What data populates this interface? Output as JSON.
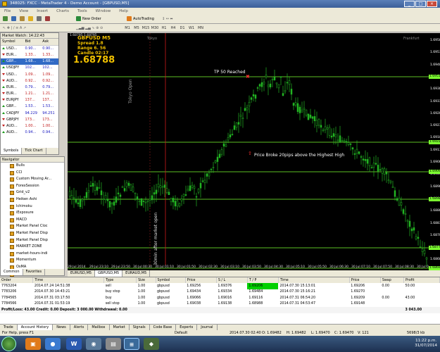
{
  "window": {
    "title": "348025: FXCC - MetaTrader 4 - Demo Account - [GBPUSD,M5]",
    "min": "_",
    "max": "□",
    "close": "×"
  },
  "menu": [
    "File",
    "View",
    "Insert",
    "Charts",
    "Tools",
    "Window",
    "Help"
  ],
  "toolbar": {
    "new_order": "New Order",
    "auto_trading": "AutoTrading",
    "timeframes": [
      "M1",
      "M5",
      "M15",
      "M30",
      "H1",
      "H4",
      "D1",
      "W1",
      "MN"
    ]
  },
  "market_watch": {
    "title": "Market Watch: 14:22:43",
    "col_symbol": "Symbol",
    "col_bid": "Bid",
    "col_ask": "Ask",
    "rows": [
      {
        "s": "USD...",
        "b": "0.90...",
        "a": "0.90...",
        "dir": "up"
      },
      {
        "s": "EUR...",
        "b": "1.33...",
        "a": "1.33...",
        "dir": "dn"
      },
      {
        "s": "GBP...",
        "b": "1.68...",
        "a": "1.68...",
        "dir": "up"
      },
      {
        "s": "USDJPY",
        "b": "102...",
        "a": "102...",
        "dir": "up"
      },
      {
        "s": "USD...",
        "b": "1.09...",
        "a": "1.09...",
        "dir": "dn"
      },
      {
        "s": "AUD...",
        "b": "0.92...",
        "a": "0.92...",
        "dir": "dn"
      },
      {
        "s": "EUR...",
        "b": "0.79...",
        "a": "0.79...",
        "dir": "up"
      },
      {
        "s": "EUR...",
        "b": "1.21...",
        "a": "1.21...",
        "dir": "dn"
      },
      {
        "s": "EURJPY",
        "b": "137...",
        "a": "137...",
        "dir": "dn"
      },
      {
        "s": "GBP...",
        "b": "1.53...",
        "a": "1.53...",
        "dir": "up"
      },
      {
        "s": "CADJPY",
        "b": "94.229",
        "a": "94.251",
        "dir": "up"
      },
      {
        "s": "GBPJPY",
        "b": "173...",
        "a": "173...",
        "dir": "dn"
      },
      {
        "s": "AUD...",
        "b": "1.00...",
        "a": "1.00...",
        "dir": "dn"
      },
      {
        "s": "AUD...",
        "b": "0.94...",
        "a": "0.94...",
        "dir": "up"
      }
    ],
    "tabs": [
      "Symbols",
      "Tick Chart"
    ]
  },
  "navigator": {
    "title": "Navigator",
    "items": [
      "Bulls",
      "CCI",
      "Custom Moving Ar...",
      "ForexSession",
      "Grid_v2",
      "Heiken Ashi",
      "Ichimoku",
      "iExposure",
      "MACD",
      "Market Panel Cloc",
      "Market Panel Disp",
      "Market Panel Disp",
      "MARKET ZONE",
      "market-hours-indi",
      "Momentum",
      "OsMA",
      "PiL CandleTime (4)",
      "Parabolic",
      "RSI"
    ],
    "tabs": [
      "Common",
      "Favorites"
    ]
  },
  "chart": {
    "symbol_line": "GBPUSD  M5",
    "spread": "Spread   1.8",
    "range": "Range   6. 56",
    "candle": "Candle   02:17",
    "price": "1.68788",
    "header_vals": "1.68795 1.68795",
    "tokyo": "Tokyo",
    "frankfurt": "Frankfurt",
    "tokyo_open": "Tokyo Open",
    "after_open": "30min after market open",
    "tp_label": "TP 50 Reached",
    "broke_label": "Price Broke 20pips above the Highest High",
    "price_ticks": [
      "1.69585",
      "1.69535",
      "1.69485",
      "1.69435",
      "1.69385",
      "1.69335",
      "1.69285",
      "1.69235",
      "1.69185",
      "1.69135",
      "1.69085",
      "1.69035",
      "1.68985",
      "1.68935",
      "1.68885",
      "1.68835",
      "1.68785",
      "1.68735",
      "1.68685"
    ],
    "highlight_prices": [
      "1.69515",
      "1.69225",
      "1.69095",
      "1.68985",
      "1.68775",
      "1.68695"
    ],
    "time_ticks": [
      "29 Jul 2014",
      "29 Jul 23:10",
      "29 Jul 23:50",
      "30 Jul 00:30",
      "30 Jul 01:10",
      "30 Jul 01:50",
      "30 Jul 02:30",
      "30 Jul 03:10",
      "30 Jul 03:50",
      "30 Jul 04:30",
      "30 Jul 05:10",
      "30 Jul 05:50",
      "30 Jul 06:30",
      "30 Jul 07:10",
      "30 Jul 07:50",
      "30 Jul 08:30",
      "30 Jul 09:10"
    ]
  },
  "chart_tabs": [
    "EURUSD,M5",
    "GBPUSD,M5",
    "EURAUD,M5"
  ],
  "terminal": {
    "cols": [
      "Order",
      "Time",
      "Type",
      "Size",
      "Symbol",
      "Price",
      "S / L",
      "T / P",
      "Time",
      "Price",
      "Swap",
      "Profit"
    ],
    "rows": [
      [
        "7763204",
        "2014.07.24 14:51:38",
        "sell",
        "1.00",
        "gbpusd",
        "1.69256",
        "1.69376",
        "1.69206",
        "2014.07.30 15:13:01",
        "1.69206",
        "0.00",
        "50.00"
      ],
      [
        "7783206",
        "2014.07.30 14:43:21",
        "buy stop",
        "1.00",
        "gbpusd",
        "1.69434",
        "1.69334",
        "1.69484",
        "2014.07.30 15:16:21",
        "1.69270",
        "",
        ""
      ],
      [
        "7784565",
        "2014.07.31 03:17:50",
        "buy",
        "1.00",
        "gbpusd",
        "1.69066",
        "1.69016",
        "1.69116",
        "2014.07.31 06:54:20",
        "1.69209",
        "0.00",
        "43.00"
      ],
      [
        "7784566",
        "2014.07.31 01:53:19",
        "sell stop",
        "1.00",
        "gbpusd",
        "1.69038",
        "1.69138",
        "1.68988",
        "2014.07.31 04:53:47",
        "1.69148",
        "",
        ""
      ]
    ],
    "summary": "Profit/Loss: 43.00   Credit: 0.00   Deposit: 3 000.00   Withdrawal: 0.00",
    "summary_total": "3 043.00",
    "tabs": [
      "Trade",
      "Account History",
      "News",
      "Alerts",
      "Mailbox",
      "Market",
      "Signals",
      "Code Base",
      "Experts",
      "Journal"
    ]
  },
  "status": {
    "help": "For Help, press F1",
    "default": "Default",
    "datetime": "2014.07.30 02:40",
    "o": "O: 1.69482",
    "h": "H: 1.69482",
    "l": "L: 1.69470",
    "c": "C: 1.69470",
    "v": "V: 121",
    "traffic": "5698/3 kb"
  },
  "taskbar": {
    "time": "11:22 p.m.",
    "date": "31/07/2014"
  },
  "colors": {
    "candle_green": "#22b422",
    "chart_bg": "#000000",
    "hline": "#7cff30",
    "vline": "#cc1a1a"
  }
}
